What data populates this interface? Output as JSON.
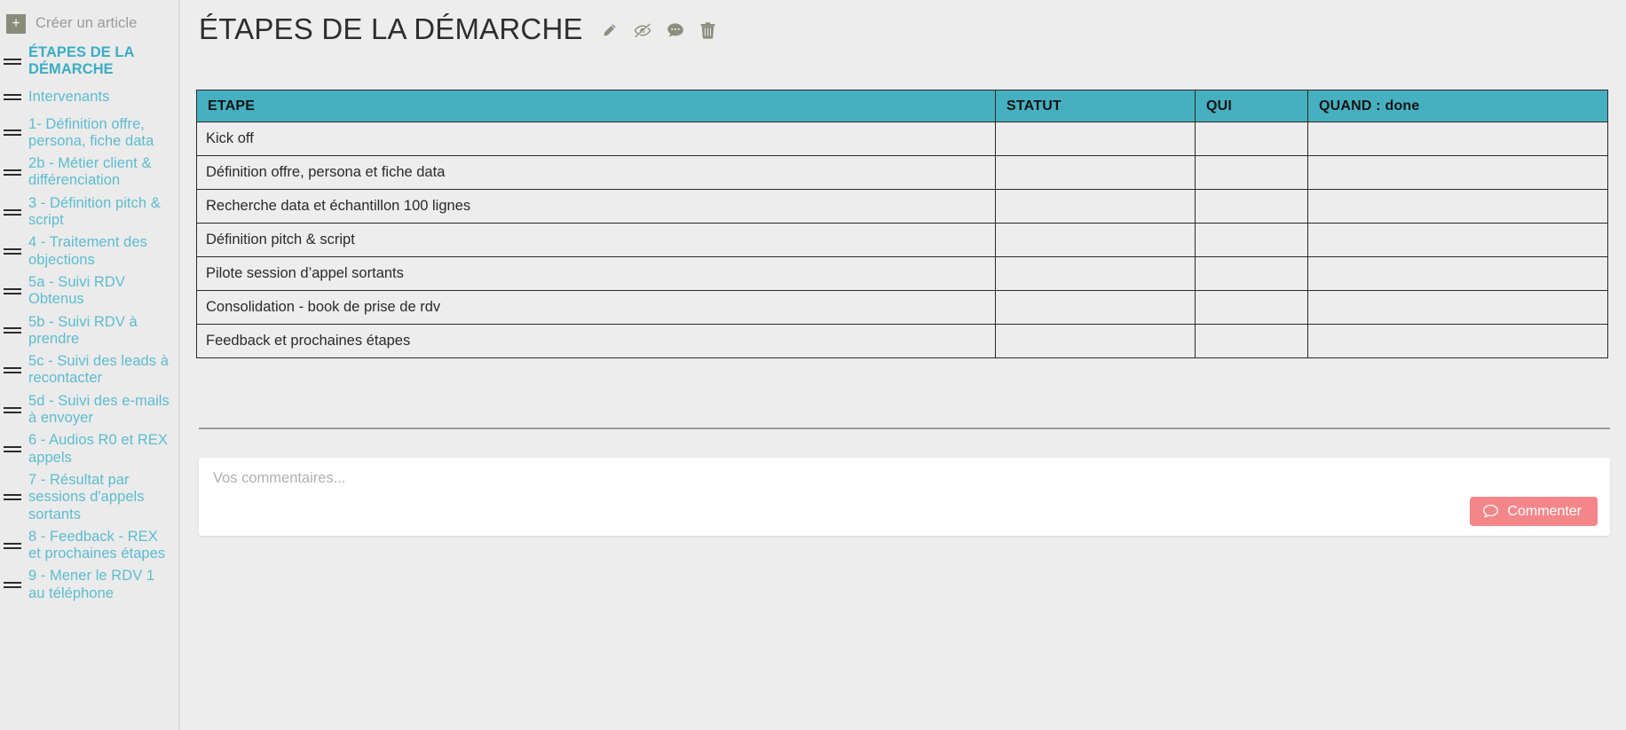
{
  "sidebar": {
    "create_article": {
      "label": "Créer un article",
      "icon": "plus-icon",
      "plus_glyph": "+"
    },
    "items": [
      {
        "label": "ÉTAPES DE LA DÉMARCHE",
        "active": true
      },
      {
        "label": "Intervenants",
        "active": false
      },
      {
        "label": "1- Définition offre, persona, fiche data",
        "active": false
      },
      {
        "label": "2b - Métier client & différenciation",
        "active": false
      },
      {
        "label": "3 - Définition pitch & script",
        "active": false
      },
      {
        "label": "4 - Traitement des objections",
        "active": false
      },
      {
        "label": "5a - Suivi RDV Obtenus",
        "active": false
      },
      {
        "label": "5b - Suivi RDV à prendre",
        "active": false
      },
      {
        "label": "5c - Suivi des leads à recontacter",
        "active": false
      },
      {
        "label": "5d - Suivi des e-mails à envoyer",
        "active": false
      },
      {
        "label": "6 - Audios R0 et REX appels",
        "active": false
      },
      {
        "label": "7 - Résultat par sessions d'appels sortants",
        "active": false
      },
      {
        "label": "8 - Feedback - REX et prochaines étapes",
        "active": false
      },
      {
        "label": "9 - Mener le RDV 1 au téléphone",
        "active": false
      }
    ]
  },
  "header": {
    "title": "ÉTAPES DE LA DÉMARCHE",
    "icons": [
      {
        "name": "edit-pencil-icon",
        "title": "Modifier"
      },
      {
        "name": "eye-slash-icon",
        "title": "Masquer"
      },
      {
        "name": "comment-bubble-icon",
        "title": "Commentaires"
      },
      {
        "name": "trash-icon",
        "title": "Supprimer"
      }
    ]
  },
  "table": {
    "columns": [
      "ETAPE",
      "STATUT",
      "QUI",
      "QUAND : done"
    ],
    "rows": [
      {
        "etape": "Kick off",
        "statut": "",
        "qui": "",
        "quand": ""
      },
      {
        "etape": "Définition offre, persona et fiche data",
        "statut": "",
        "qui": "",
        "quand": ""
      },
      {
        "etape": "Recherche data et échantillon 100 lignes",
        "statut": "",
        "qui": "",
        "quand": ""
      },
      {
        "etape": "Définition pitch & script",
        "statut": "",
        "qui": "",
        "quand": ""
      },
      {
        "etape": "Pilote session d’appel sortants",
        "statut": "",
        "qui": "",
        "quand": ""
      },
      {
        "etape": "Consolidation - book de prise de rdv",
        "statut": "",
        "qui": "",
        "quand": ""
      },
      {
        "etape": "Feedback et prochaines étapes",
        "statut": "",
        "qui": "",
        "quand": ""
      }
    ]
  },
  "comments": {
    "placeholder": "Vos commentaires...",
    "value": "",
    "submit_label": "Commenter",
    "submit_icon": "comment-bubble-icon"
  },
  "colors": {
    "accent_teal": "#46b0c0",
    "link_teal": "#5cbcd0",
    "button_coral": "#f4868a",
    "page_bg": "#ededed",
    "sidebar_bg": "#ebebeb",
    "icon_olive": "#8c8e7e"
  }
}
